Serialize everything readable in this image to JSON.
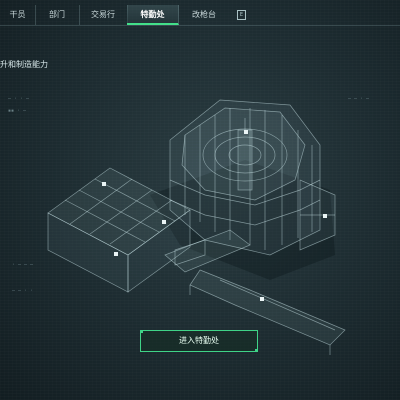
{
  "nav": {
    "tabs": [
      {
        "label": "干员",
        "active": false
      },
      {
        "label": "部门",
        "active": false
      },
      {
        "label": "交易行",
        "active": false
      },
      {
        "label": "特勤处",
        "active": true
      },
      {
        "label": "改枪台",
        "active": false
      }
    ],
    "accent": "#43e08a"
  },
  "subtitle": "升和制造能力",
  "enter_button": {
    "label": "进入特勤处"
  },
  "icons": [
    "facility-marker-icon",
    "nav-badge-icon"
  ]
}
